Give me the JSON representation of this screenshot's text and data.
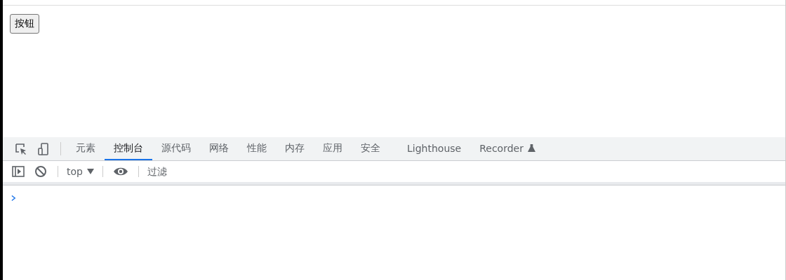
{
  "page": {
    "button": "按钮"
  },
  "devtools": {
    "tabs": [
      {
        "label": "元素",
        "selected": false,
        "experimental": false
      },
      {
        "label": "控制台",
        "selected": true,
        "experimental": false
      },
      {
        "label": "源代码",
        "selected": false,
        "experimental": false
      },
      {
        "label": "网络",
        "selected": false,
        "experimental": false
      },
      {
        "label": "性能",
        "selected": false,
        "experimental": false
      },
      {
        "label": "内存",
        "selected": false,
        "experimental": false
      },
      {
        "label": "应用",
        "selected": false,
        "experimental": false
      },
      {
        "label": "安全",
        "selected": false,
        "experimental": false
      },
      {
        "label": "Lighthouse",
        "selected": false,
        "experimental": false
      },
      {
        "label": "Recorder",
        "selected": false,
        "experimental": true
      }
    ],
    "context": "top",
    "filter": {
      "placeholder": "过滤"
    }
  }
}
